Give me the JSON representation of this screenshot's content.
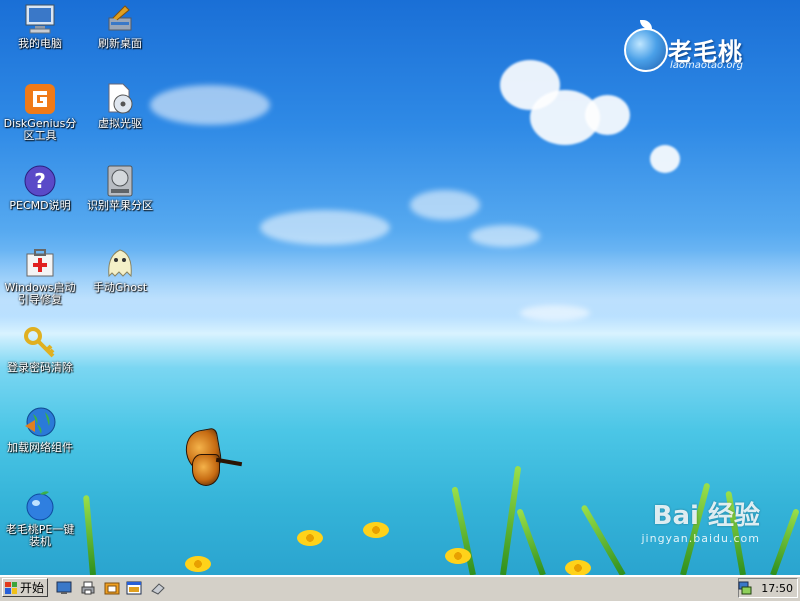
{
  "desktop": {
    "icons": [
      {
        "label": "我的电脑",
        "icon": "computer-icon"
      },
      {
        "label": "刷新桌面",
        "icon": "refresh-desktop-icon"
      },
      {
        "label": "DiskGenius分区工具",
        "icon": "diskgenius-icon"
      },
      {
        "label": "虚拟光驱",
        "icon": "virtual-cd-icon"
      },
      {
        "label": "PECMD说明",
        "icon": "help-icon"
      },
      {
        "label": "识别苹果分区",
        "icon": "hard-drive-icon"
      },
      {
        "label": "Windows启动引导修复",
        "icon": "first-aid-icon"
      },
      {
        "label": "手动Ghost",
        "icon": "ghost-icon"
      },
      {
        "label": "登录密码清除",
        "icon": "key-icon"
      },
      {
        "label": "加载网络组件",
        "icon": "globe-icon"
      },
      {
        "label": "老毛桃PE一键装机",
        "icon": "apple-logo-icon"
      }
    ]
  },
  "logo": {
    "name": "老毛桃",
    "url": "laomaotao.org"
  },
  "watermark": {
    "main": "Bai 经验",
    "sub": "jingyan.baidu.com"
  },
  "taskbar": {
    "start_label": "开始",
    "quick_launch": [
      "desktop-icon",
      "printer-icon",
      "folder-icon",
      "window-icon",
      "eraser-icon"
    ],
    "clock": "17:50",
    "tray_icon": "network-icon"
  },
  "colors": {
    "sky": "#2f8ae6",
    "sea": "#34b3d8",
    "taskbar": "#d4d0c8"
  }
}
